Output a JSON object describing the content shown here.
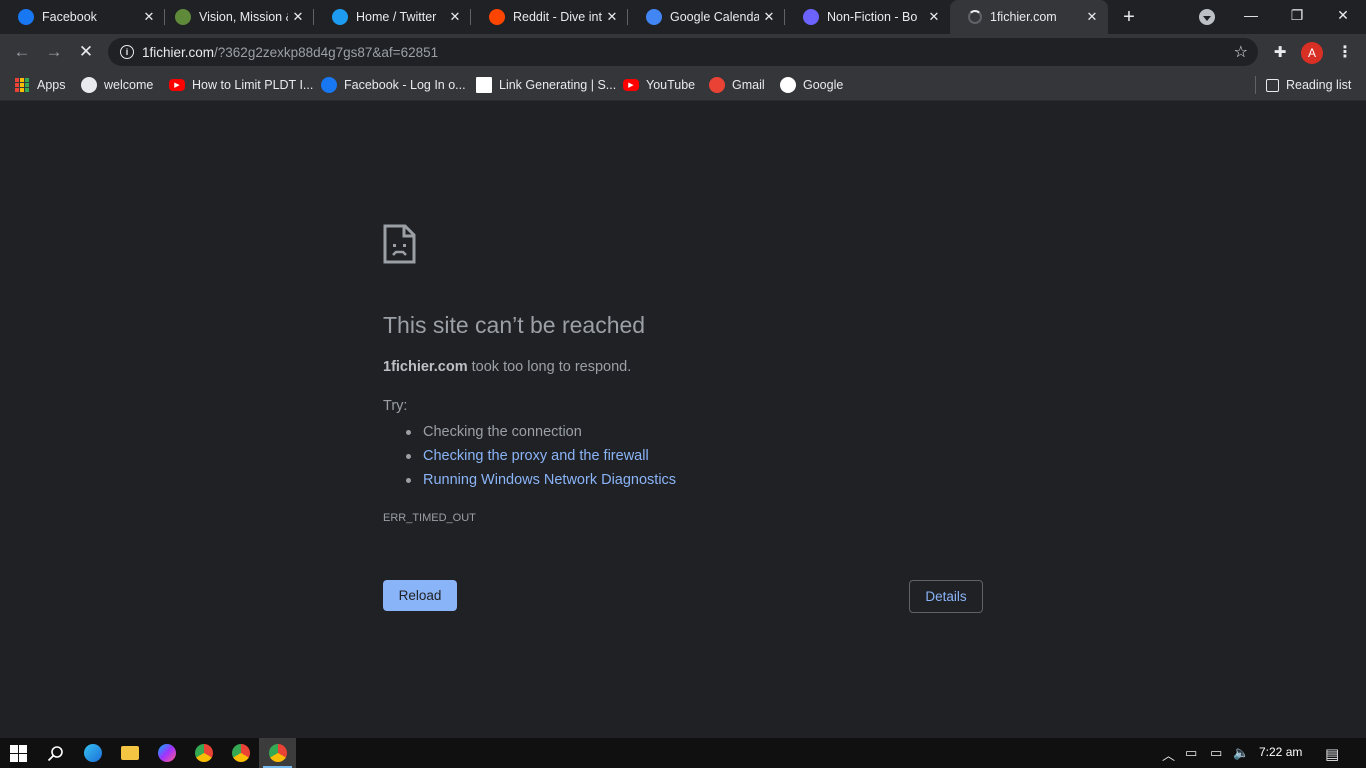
{
  "tabs": [
    {
      "title": "Facebook",
      "favicon": "facebook-icon",
      "color": "#1877f2"
    },
    {
      "title": "Vision, Mission &",
      "favicon": "globe-diamond-icon",
      "color": "#5f8a3a"
    },
    {
      "title": "Home / Twitter",
      "favicon": "twitter-icon",
      "color": "#1d9bf0"
    },
    {
      "title": "Reddit - Dive into",
      "favicon": "reddit-icon",
      "color": "#ff4500"
    },
    {
      "title": "Google Calendar",
      "favicon": "google-calendar-icon",
      "color": "#4285f4"
    },
    {
      "title": "Non-Fiction - Bo",
      "favicon": "shield-icon",
      "color": "#6c63ff"
    },
    {
      "title": "1fichier.com",
      "favicon": "loading-spinner-icon",
      "color": "#e8eaed",
      "active": true
    }
  ],
  "window": {
    "minimize": "—",
    "restore": "❐",
    "close": "✕"
  },
  "toolbar": {
    "url_host": "1fichier.com",
    "url_path": "/?362g2zexkp88d4g7gs87&af=62851",
    "profile_initial": "A"
  },
  "bookmarks": [
    {
      "label": "Apps",
      "icon": "apps-grid-icon"
    },
    {
      "label": "welcome",
      "icon": "globe-icon",
      "color": "#e8eaed"
    },
    {
      "label": "How to Limit PLDT I...",
      "icon": "youtube-icon",
      "color": "#ff0000"
    },
    {
      "label": "Facebook - Log In o...",
      "icon": "facebook-icon",
      "color": "#1877f2"
    },
    {
      "label": "Link Generating | S...",
      "icon": "page-icon",
      "color": "#ffffff"
    },
    {
      "label": "YouTube",
      "icon": "youtube-icon",
      "color": "#ff0000"
    },
    {
      "label": "Gmail",
      "icon": "gmail-icon",
      "color": "#ea4335"
    },
    {
      "label": "Google",
      "icon": "google-icon",
      "color": "#ffffff"
    }
  ],
  "reading_list": "Reading list",
  "error": {
    "title": "This site can’t be reached",
    "host": "1fichier.com",
    "message": " took too long to respond.",
    "try_label": "Try:",
    "tips": [
      {
        "text": "Checking the connection",
        "link": false
      },
      {
        "text": "Checking the proxy and the firewall",
        "link": true
      },
      {
        "text": "Running Windows Network Diagnostics",
        "link": true
      }
    ],
    "code": "ERR_TIMED_OUT",
    "reload_label": "Reload",
    "details_label": "Details"
  },
  "taskbar": {
    "apps": [
      "start-icon",
      "search-icon",
      "edge-icon",
      "file-explorer-icon",
      "messenger-icon",
      "chrome-icon",
      "chrome-icon",
      "chrome-icon"
    ],
    "time": "7:22 am"
  }
}
